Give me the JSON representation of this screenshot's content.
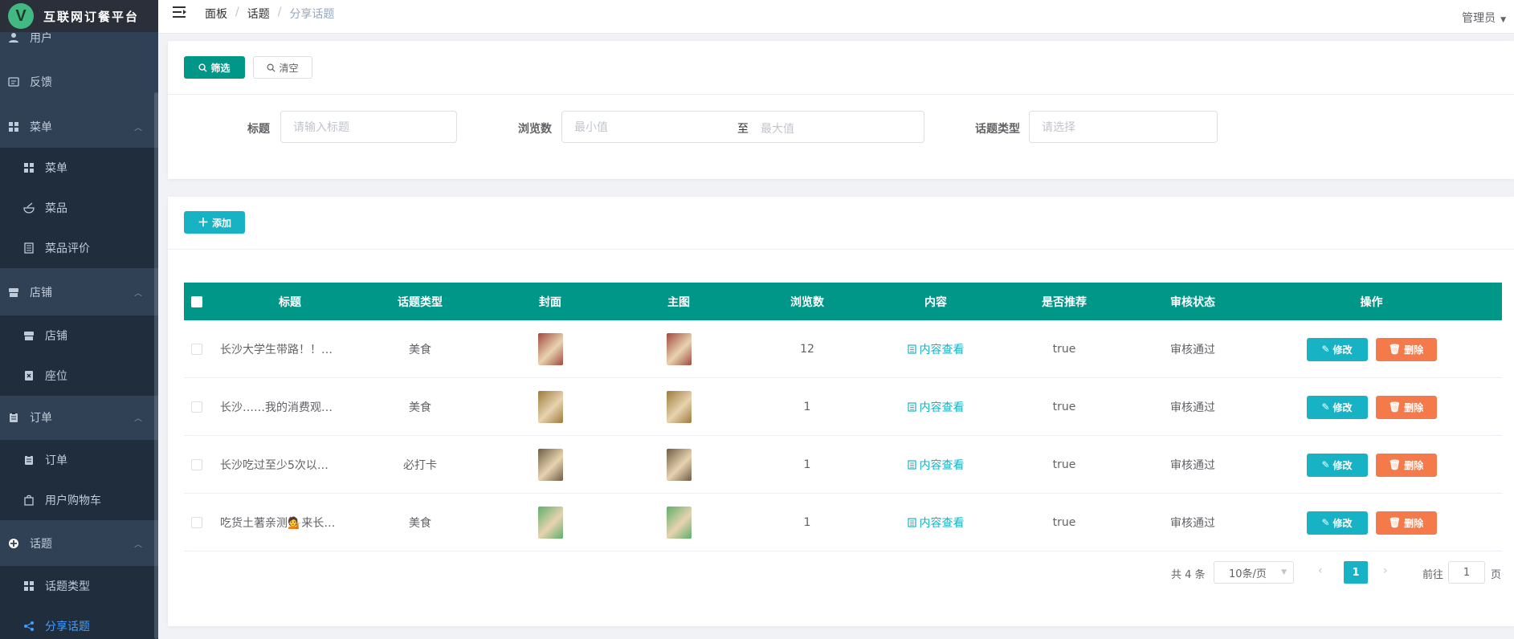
{
  "app": {
    "title": "互联网订餐平台",
    "logo_letter": "V"
  },
  "sidebar": {
    "items": [
      {
        "label": "用户",
        "icon": "user-icon",
        "kind": "top"
      },
      {
        "label": "反馈",
        "icon": "feedback-icon",
        "kind": "top"
      },
      {
        "label": "菜单",
        "icon": "grid-icon",
        "kind": "parent"
      },
      {
        "label": "菜单",
        "icon": "grid-icon",
        "kind": "child"
      },
      {
        "label": "菜品",
        "icon": "bowl-icon",
        "kind": "child"
      },
      {
        "label": "菜品评价",
        "icon": "list-icon",
        "kind": "child"
      },
      {
        "label": "店铺",
        "icon": "store-icon",
        "kind": "parent"
      },
      {
        "label": "店铺",
        "icon": "store-icon",
        "kind": "child"
      },
      {
        "label": "座位",
        "icon": "seat-icon",
        "kind": "child"
      },
      {
        "label": "订单",
        "icon": "clipboard-icon",
        "kind": "parent"
      },
      {
        "label": "订单",
        "icon": "clipboard-icon",
        "kind": "child"
      },
      {
        "label": "用户购物车",
        "icon": "bag-icon",
        "kind": "child"
      },
      {
        "label": "话题",
        "icon": "topic-icon",
        "kind": "parent"
      },
      {
        "label": "话题类型",
        "icon": "grid-icon",
        "kind": "child"
      },
      {
        "label": "分享话题",
        "icon": "share-icon",
        "kind": "child",
        "active": true
      }
    ]
  },
  "header": {
    "breadcrumb": [
      "面板",
      "话题",
      "分享话题"
    ],
    "user": "管理员"
  },
  "filter": {
    "search_label": "筛选",
    "clear_label": "清空",
    "title_label": "标题",
    "title_placeholder": "请输入标题",
    "views_label": "浏览数",
    "views_min_placeholder": "最小值",
    "views_to": "至",
    "views_max_placeholder": "最大值",
    "type_label": "话题类型",
    "type_placeholder": "请选择"
  },
  "toolbar": {
    "add_label": "添加"
  },
  "table": {
    "columns": [
      "标题",
      "话题类型",
      "封面",
      "主图",
      "浏览数",
      "内容",
      "是否推荐",
      "审核状态",
      "操作"
    ],
    "rows": [
      {
        "title": "长沙大学生带路！！…",
        "type": "美食",
        "views": "12",
        "content": "内容查看",
        "recommend": "true",
        "status": "审核通过",
        "thumb_color": "#a04a3c"
      },
      {
        "title": "长沙……我的消费观…",
        "type": "美食",
        "views": "1",
        "content": "内容查看",
        "recommend": "true",
        "status": "审核通过",
        "thumb_color": "#9c7a3a"
      },
      {
        "title": "长沙吃过至少5次以…",
        "type": "必打卡",
        "views": "1",
        "content": "内容查看",
        "recommend": "true",
        "status": "审核通过",
        "thumb_color": "#6d5d44"
      },
      {
        "title": "吃货土著亲测💁来长…",
        "type": "美食",
        "views": "1",
        "content": "内容查看",
        "recommend": "true",
        "status": "审核通过",
        "thumb_color": "#5fae6a"
      }
    ],
    "edit_label": "修改",
    "delete_label": "删除"
  },
  "pagination": {
    "total": "共 4 条",
    "page_size": "10条/页",
    "current_page": "1",
    "goto_label": "前往",
    "goto_value": "1",
    "page_unit": "页"
  },
  "colors": {
    "primary": "#009688",
    "accent": "#17b3c5",
    "danger": "#f47a4c",
    "sidebar": "#304156"
  }
}
